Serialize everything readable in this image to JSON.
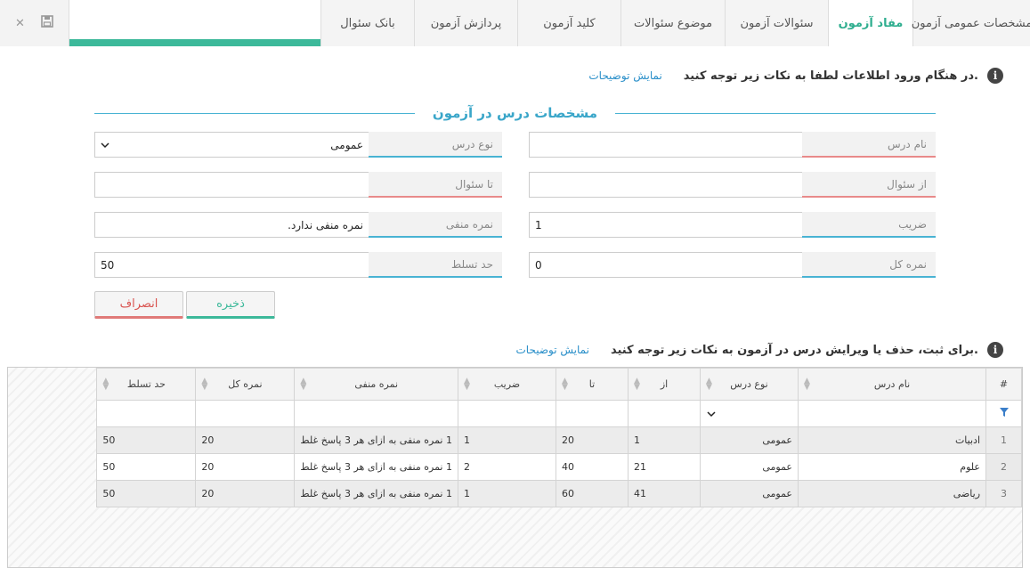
{
  "tabs": [
    {
      "label": "مشخصات عمومی آزمون",
      "width": 132
    },
    {
      "label": "مفاد آزمون",
      "width": 95,
      "active": true
    },
    {
      "label": "سئوالات آزمون",
      "width": 116
    },
    {
      "label": "موضوع سئوالات",
      "width": 117
    },
    {
      "label": "کلید آزمون",
      "width": 116
    },
    {
      "label": "پردازش آزمون",
      "width": 116
    },
    {
      "label": "بانک سئوال",
      "width": 105
    }
  ],
  "toolbar": {
    "close_glyph": "✕",
    "save_glyph": "🖫"
  },
  "info1": {
    "text": "در هنگام ورود اطلاعات لطفا به نکات زیر توجه کنید.",
    "link": "نمایش توضیحات"
  },
  "section": {
    "title": "مشخصات درس در آزمون"
  },
  "form": {
    "course_name": {
      "label": "نام درس",
      "value": ""
    },
    "course_type": {
      "label": "نوع درس",
      "value": "عمومی"
    },
    "from_question": {
      "label": "از سئوال",
      "value": ""
    },
    "to_question": {
      "label": "تا سئوال",
      "value": ""
    },
    "coefficient": {
      "label": "ضریب",
      "value": "1"
    },
    "negative_mark": {
      "label": "نمره منفی",
      "value": "نمره منفی ندارد."
    },
    "total_mark": {
      "label": "نمره کل",
      "value": "0"
    },
    "mastery": {
      "label": "حد تسلط",
      "value": "50"
    }
  },
  "buttons": {
    "save": "ذخیره",
    "cancel": "انصراف"
  },
  "info2": {
    "text": "برای ثبت، حذف یا ویرایش درس در آزمون به نکات زیر توجه کنید.",
    "link": "نمایش توضیحات"
  },
  "grid": {
    "headers": [
      "#",
      "نام درس",
      "نوع درس",
      "از",
      "تا",
      "ضریب",
      "نمره منفی",
      "نمره کل",
      "حد تسلط"
    ],
    "rows": [
      [
        "1",
        "ادبیات",
        "عمومی",
        "1",
        "20",
        "1",
        "1 نمره منفی به ازای هر 3 پاسخ غلط",
        "20",
        "50"
      ],
      [
        "2",
        "علوم",
        "عمومی",
        "21",
        "40",
        "2",
        "1 نمره منفی به ازای هر 3 پاسخ غلط",
        "20",
        "50"
      ],
      [
        "3",
        "ریاضی",
        "عمومی",
        "41",
        "60",
        "1",
        "1 نمره منفی به ازای هر 3 پاسخ غلط",
        "20",
        "50"
      ]
    ]
  },
  "colors": {
    "accent": "#3cb99a",
    "link": "#2a8fc9",
    "section": "#3aa6c9",
    "danger": "#d9534f"
  }
}
